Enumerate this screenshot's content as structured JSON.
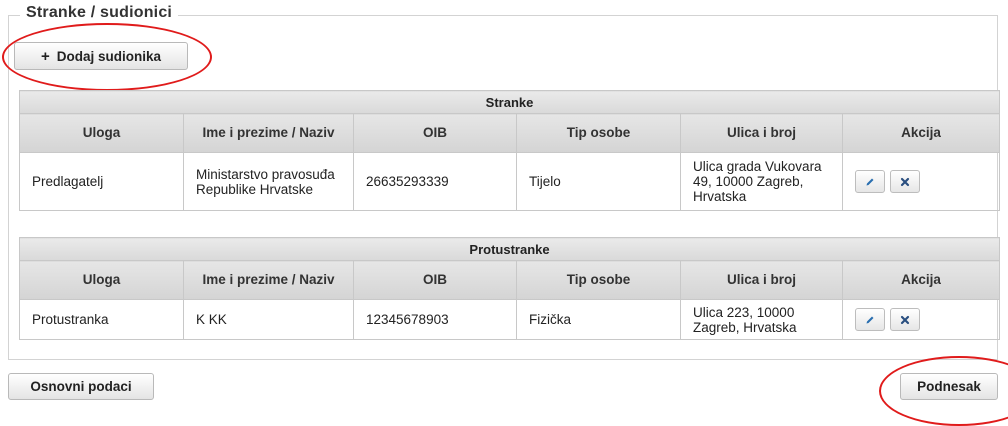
{
  "section": {
    "legend": "Stranke / sudionici"
  },
  "add_button": {
    "label": "Dodaj sudionika",
    "icon": "plus-icon"
  },
  "column_headers": [
    "Uloga",
    "Ime i prezime / Naziv",
    "OIB",
    "Tip osobe",
    "Ulica i broj",
    "Akcija"
  ],
  "stranke": {
    "title": "Stranke",
    "rows": [
      {
        "uloga": "Predlagatelj",
        "naziv": "Ministarstvo pravosuđa Republike Hrvatske",
        "oib": "26635293339",
        "tip": "Tijelo",
        "adresa": "Ulica grada Vukovara 49, 10000 Zagreb, Hrvatska"
      }
    ]
  },
  "protustranke": {
    "title": "Protustranke",
    "rows": [
      {
        "uloga": "Protustranka",
        "naziv": "K KK",
        "oib": "12345678903",
        "tip": "Fizička",
        "adresa": "Ulica 223, 10000 Zagreb, Hrvatska"
      }
    ]
  },
  "footer": {
    "back_label": "Osnovni podaci",
    "next_label": "Podnesak"
  },
  "colors": {
    "annotation_ring": "#e01b1b",
    "border": "#c8c8c8",
    "header_bg": "#d9d9d9"
  },
  "icons": {
    "edit": "pencil-icon",
    "delete": "x-icon"
  }
}
